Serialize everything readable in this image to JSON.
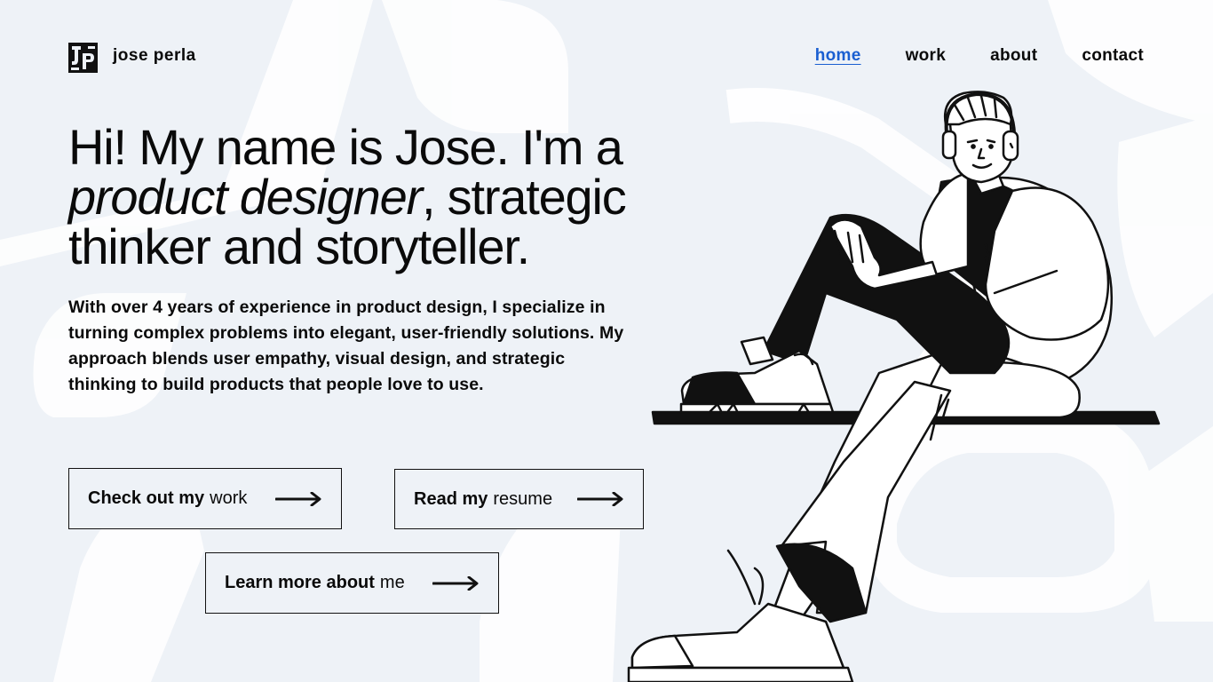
{
  "header": {
    "brand": "jose perla",
    "logo_icon": "jp-monogram-logo",
    "nav": [
      {
        "label": "home",
        "active": true
      },
      {
        "label": "work",
        "active": false
      },
      {
        "label": "about",
        "active": false
      },
      {
        "label": "contact",
        "active": false
      }
    ]
  },
  "hero": {
    "headline_line1": "Hi! My name is Jose. I'm a",
    "headline_italic": "product designer",
    "headline_after_italic": ", strategic",
    "headline_line3": "thinker and storyteller.",
    "intro": "With over 4 years of experience in product design, I specialize in turning complex problems into elegant, user-friendly solutions. My approach blends user empathy, visual design, and strategic thinking to build products that people love to use."
  },
  "buttons": {
    "work": {
      "bold": "Check out my",
      "normal": "work",
      "icon": "arrow-right-icon"
    },
    "resume": {
      "bold": "Read my",
      "normal": "resume",
      "icon": "arrow-right-icon"
    },
    "about": {
      "bold": "Learn more about",
      "normal": "me",
      "icon": "arrow-right-icon"
    }
  },
  "colors": {
    "background": "#eef2f7",
    "background_shapes": "#ffffff",
    "active_link": "#1a5fd1",
    "text": "#0a0a0a"
  }
}
